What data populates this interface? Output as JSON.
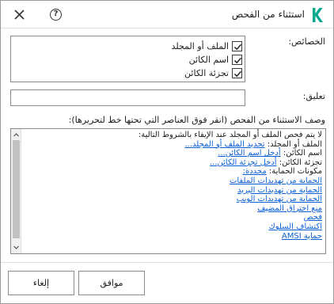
{
  "window": {
    "title": "استثناء من الفحص",
    "help_glyph": "?",
    "logo_icon": "kaspersky-k-icon",
    "accent": "#00a88e"
  },
  "properties": {
    "label": "الخصائص:",
    "items": [
      {
        "label": "الملف أو المجلد",
        "checked": true
      },
      {
        "label": "اسم الكائن",
        "checked": true
      },
      {
        "label": "تجزئة الكائن",
        "checked": true
      }
    ]
  },
  "comment": {
    "label": "تعليق:",
    "value": ""
  },
  "description": {
    "label": "وصف الاستثناء من الفحص (انقر فوق العناصر التي تحتها خط لتحريرها):",
    "header": "لا يتم فحص الملف أو المجلد عند الإيفاء بالشروط التالية:",
    "file_label": "الملف أو المجلد:",
    "file_link": "تحديد الملف أو المجلد...",
    "name_label": "اسم الكائن:",
    "name_link": "أدخل اسم الكائن...",
    "hash_label": "تجزئة الكائن:",
    "hash_link": "أدخل تجزئة الكائن...",
    "components_label": "مكونات الحماية:",
    "components_selected": "محددة:",
    "components": [
      "الحماية من تهديدات الملفات",
      "الحماية من تهديدات البريد",
      "الحماية من تهديدات الويب",
      "منع اختراق المضيف",
      "فحص",
      "اكتشاف السلوك",
      "حماية AMSI"
    ],
    "link_color": "#0b5fd6"
  },
  "footer": {
    "ok_label": "موافق",
    "cancel_label": "إلغاء"
  }
}
